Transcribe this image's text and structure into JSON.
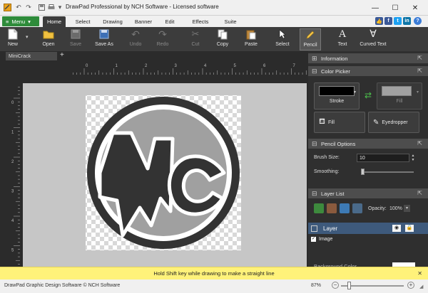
{
  "app": {
    "title": "DrawPad Professional by NCH Software - Licensed software",
    "window_controls": [
      "—",
      "☐",
      "✕"
    ]
  },
  "menu_button": {
    "label": "Menu",
    "chevron": "▾"
  },
  "tabs": [
    "Home",
    "Select",
    "Drawing",
    "Banner",
    "Edit",
    "Effects",
    "Suite"
  ],
  "active_tab": "Home",
  "social_icons": [
    "like-icon",
    "facebook-icon",
    "twitter-icon",
    "linkedin-icon",
    "help-icon"
  ],
  "ribbon": {
    "new": "New",
    "open": "Open",
    "save": "Save",
    "save_as": "Save As",
    "undo": "Undo",
    "redo": "Redo",
    "cut": "Cut",
    "copy": "Copy",
    "paste": "Paste",
    "select": "Select",
    "pencil": "Pencil",
    "text": "Text",
    "curved_text": "Curved Text"
  },
  "document": {
    "tab_name": "MiniCrack",
    "add_tab": "+"
  },
  "ruler": {
    "h_labels": [
      "0",
      "1",
      "2",
      "3",
      "4",
      "5",
      "6",
      "7"
    ],
    "v_labels": [
      "0",
      "1",
      "2",
      "3",
      "4",
      "5"
    ]
  },
  "panels": {
    "information": "Information",
    "color_picker": "Color Picker",
    "stroke": "Stroke",
    "fill_swatch": "Fill",
    "fill_button": "Fill",
    "eyedropper": "Eyedropper",
    "pencil_options": "Pencil Options",
    "brush_size_label": "Brush Size:",
    "brush_size_value": "10",
    "smoothing_label": "Smoothing:",
    "smoothing_level": 0,
    "layer_list": "Layer List",
    "opacity_label": "Opacity:",
    "opacity_value": "100%",
    "layer_name": "Layer",
    "image_item": "Image",
    "background_color": "Background Color"
  },
  "hint": {
    "text": "Hold Shift key while drawing to make a straight line",
    "close": "✕"
  },
  "status": {
    "left": "DrawPad Graphic Design Software © NCH Software",
    "zoom": "87%",
    "zoom_level": 0.87
  },
  "colors": {
    "ribbon_bg": "#3c3c3c",
    "menu_green": "#2e8b3a",
    "logo_dark": "#333333",
    "logo_gray": "#a0a0a0",
    "hint_yellow": "#fff27a"
  }
}
